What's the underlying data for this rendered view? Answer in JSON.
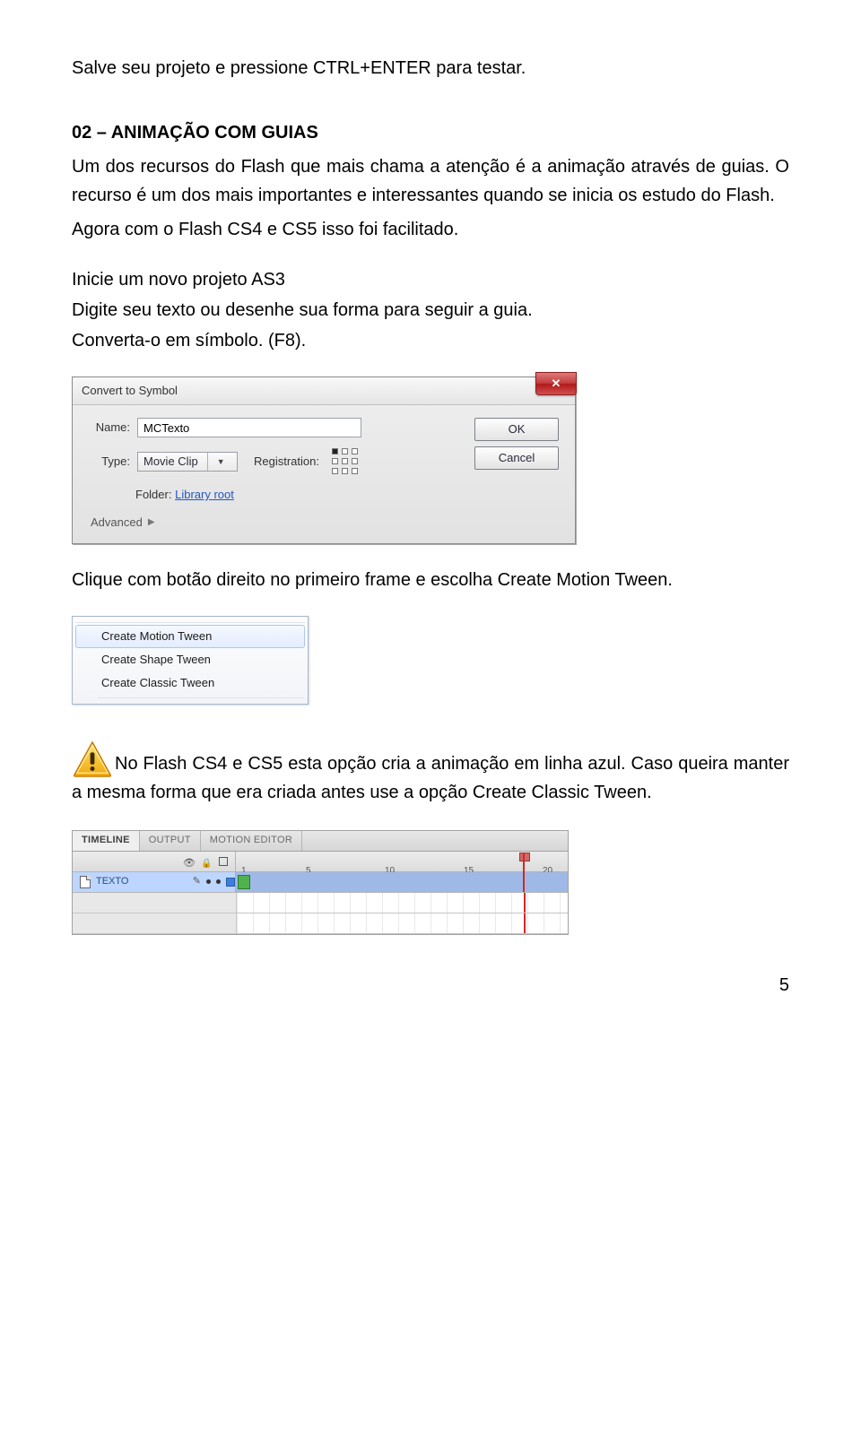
{
  "intro_line": "Salve seu projeto e pressione CTRL+ENTER para testar.",
  "heading": "02 – ANIMAÇÃO COM GUIAS",
  "p1": "Um dos recursos do Flash que mais chama a atenção é a animação através de guias. O recurso é um dos mais importantes e interessantes quando se inicia os estudo do Flash.",
  "p2": "Agora com o Flash CS4 e CS5 isso foi facilitado.",
  "p3": "Inicie um novo projeto AS3",
  "p4": "Digite seu texto ou desenhe sua forma para seguir a guia.",
  "p5": "Converta-o em símbolo. (F8).",
  "dialog": {
    "title": "Convert to Symbol",
    "name_label": "Name:",
    "name_value": "MCTexto",
    "type_label": "Type:",
    "type_value": "Movie Clip",
    "reg_label": "Registration:",
    "ok": "OK",
    "cancel": "Cancel",
    "folder_label": "Folder:",
    "folder_link": "Library root",
    "advanced": "Advanced"
  },
  "after_dialog": "Clique com botão direito no primeiro frame e escolha Create Motion Tween.",
  "menu": {
    "items": [
      {
        "label": "Create Motion Tween",
        "hover": true
      },
      {
        "label": "Create Shape Tween",
        "hover": false
      },
      {
        "label": "Create Classic Tween",
        "hover": false
      }
    ]
  },
  "note": "No Flash CS4 e CS5 esta opção cria a animação em linha azul. Caso queira manter a mesma forma que era criada antes use a opção Create Classic Tween.",
  "timeline": {
    "tabs": [
      "TIMELINE",
      "OUTPUT",
      "MOTION EDITOR"
    ],
    "ticks": [
      "1",
      "5",
      "10",
      "15",
      "20"
    ],
    "layer": "TEXTO"
  },
  "pagenum": "5"
}
